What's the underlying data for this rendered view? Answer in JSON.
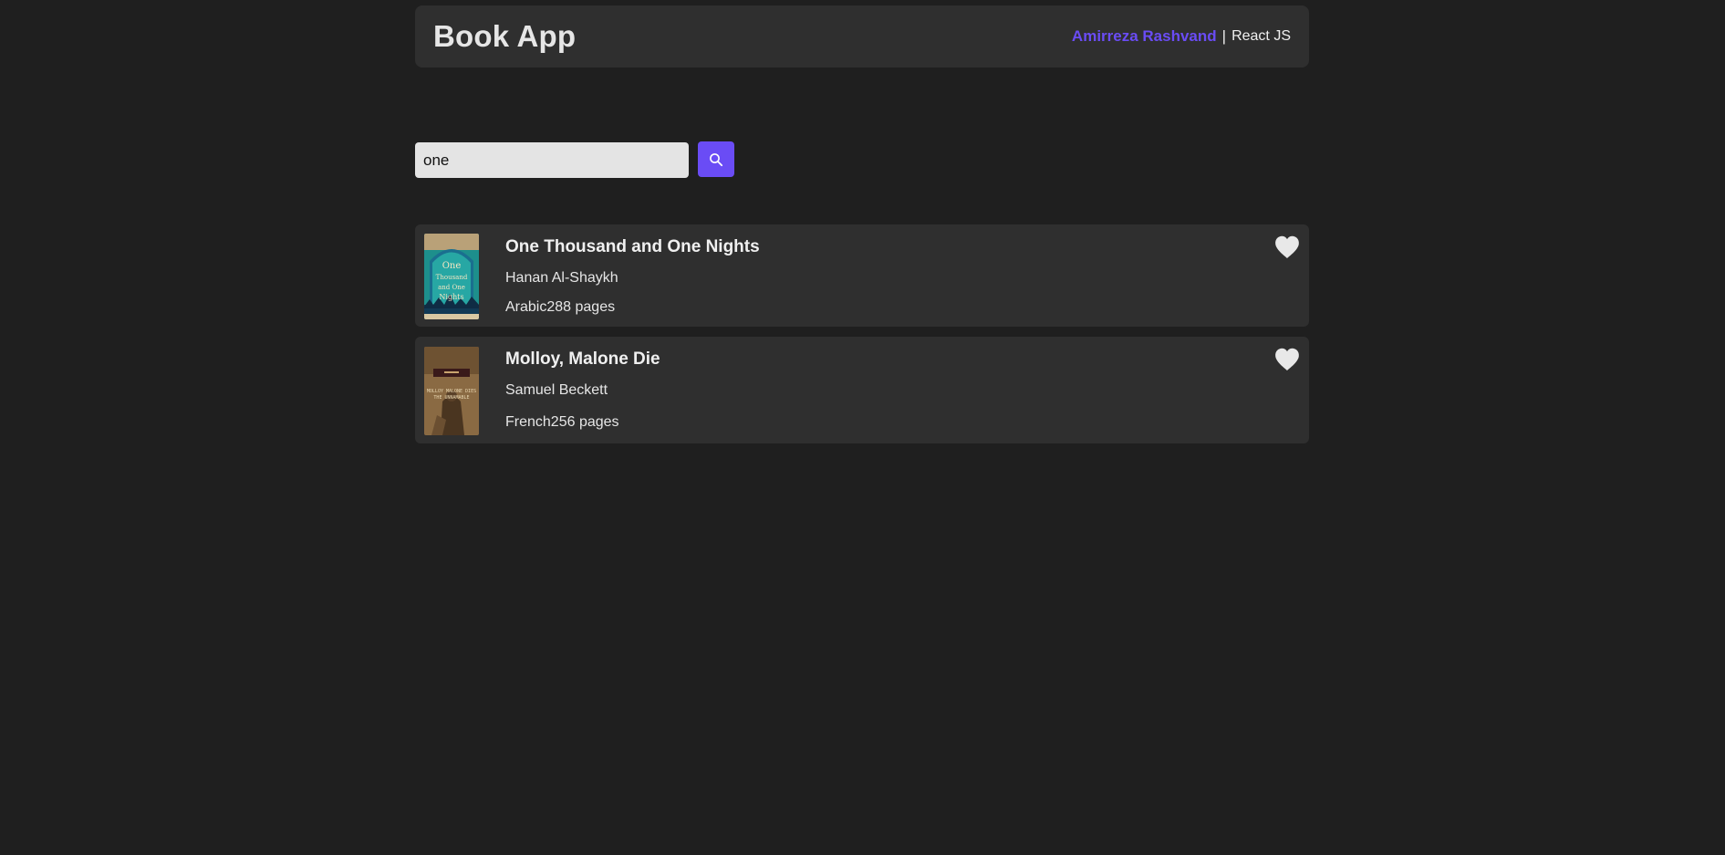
{
  "header": {
    "title": "Book App",
    "author_name": "Amirreza Rashvand",
    "separator": "|",
    "tech": "React JS",
    "accent_color": "#6a4cf5"
  },
  "search": {
    "value": "one",
    "placeholder": "",
    "button_icon": "search-icon"
  },
  "books": [
    {
      "title": "One Thousand and One Nights",
      "author": "Hanan Al-Shaykh",
      "meta": "Arabic288 pages",
      "cover_lettering": "One Thousand and One Nights",
      "favorite_icon": "heart-icon"
    },
    {
      "title": "Molloy, Malone Die",
      "author": "Samuel Beckett",
      "meta": "French256 pages",
      "cover_lettering": "Molloy, Malone Dies, The Unnamable",
      "favorite_icon": "heart-icon"
    }
  ]
}
